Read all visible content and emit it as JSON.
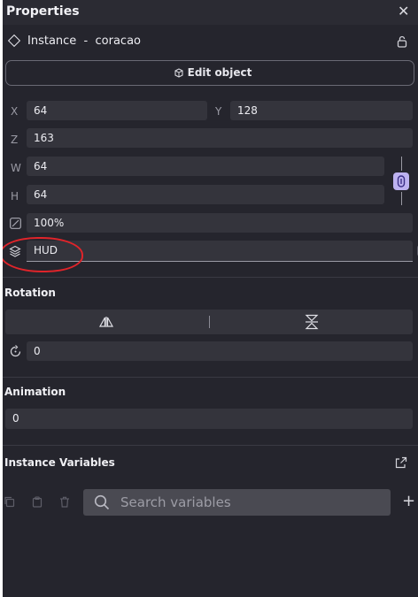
{
  "header": {
    "title": "Properties"
  },
  "instance": {
    "label": "Instance  -  coracao"
  },
  "edit_button": {
    "label": "Edit object"
  },
  "position": {
    "x_label": "X",
    "x_value": "64",
    "y_label": "Y",
    "y_value": "128",
    "z_label": "Z",
    "z_value": "163",
    "w_label": "W",
    "w_value": "64",
    "h_label": "H",
    "h_value": "64",
    "opacity_value": "100%",
    "layer_value": "HUD"
  },
  "rotation": {
    "title": "Rotation",
    "angle_value": "0"
  },
  "animation": {
    "title": "Animation",
    "value": "0"
  },
  "instance_variables": {
    "title": "Instance Variables",
    "search_placeholder": "Search variables"
  },
  "colors": {
    "panel_bg": "#25252d",
    "field_bg": "#34343c",
    "accent": "#bdb2f0",
    "annotation": "#e0242a"
  }
}
